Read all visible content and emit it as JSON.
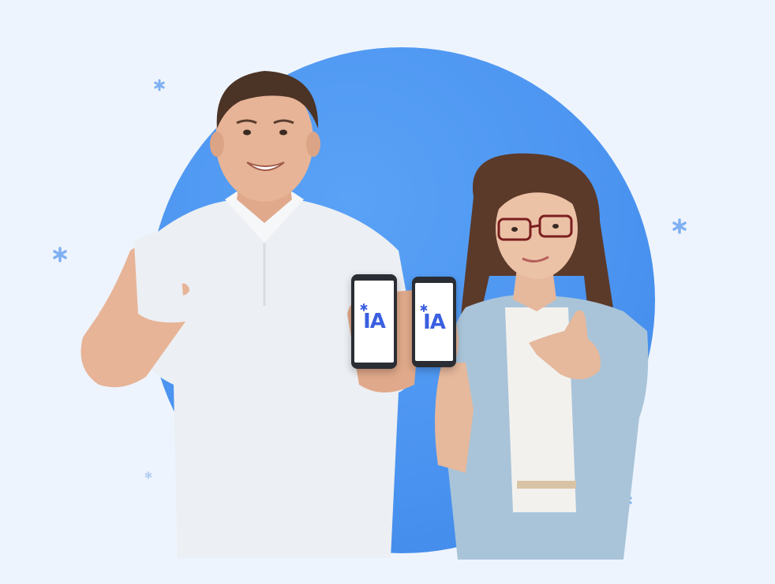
{
  "colors": {
    "background": "#eef4fd",
    "circle": "#4a93f0",
    "logo": "#3a5fe0",
    "sparkle": "#7fb0f2"
  },
  "phones": [
    {
      "logo_text": "IA"
    },
    {
      "logo_text": "IA"
    }
  ],
  "icons": [
    "sparkle-icon",
    "asterisk-icon"
  ]
}
